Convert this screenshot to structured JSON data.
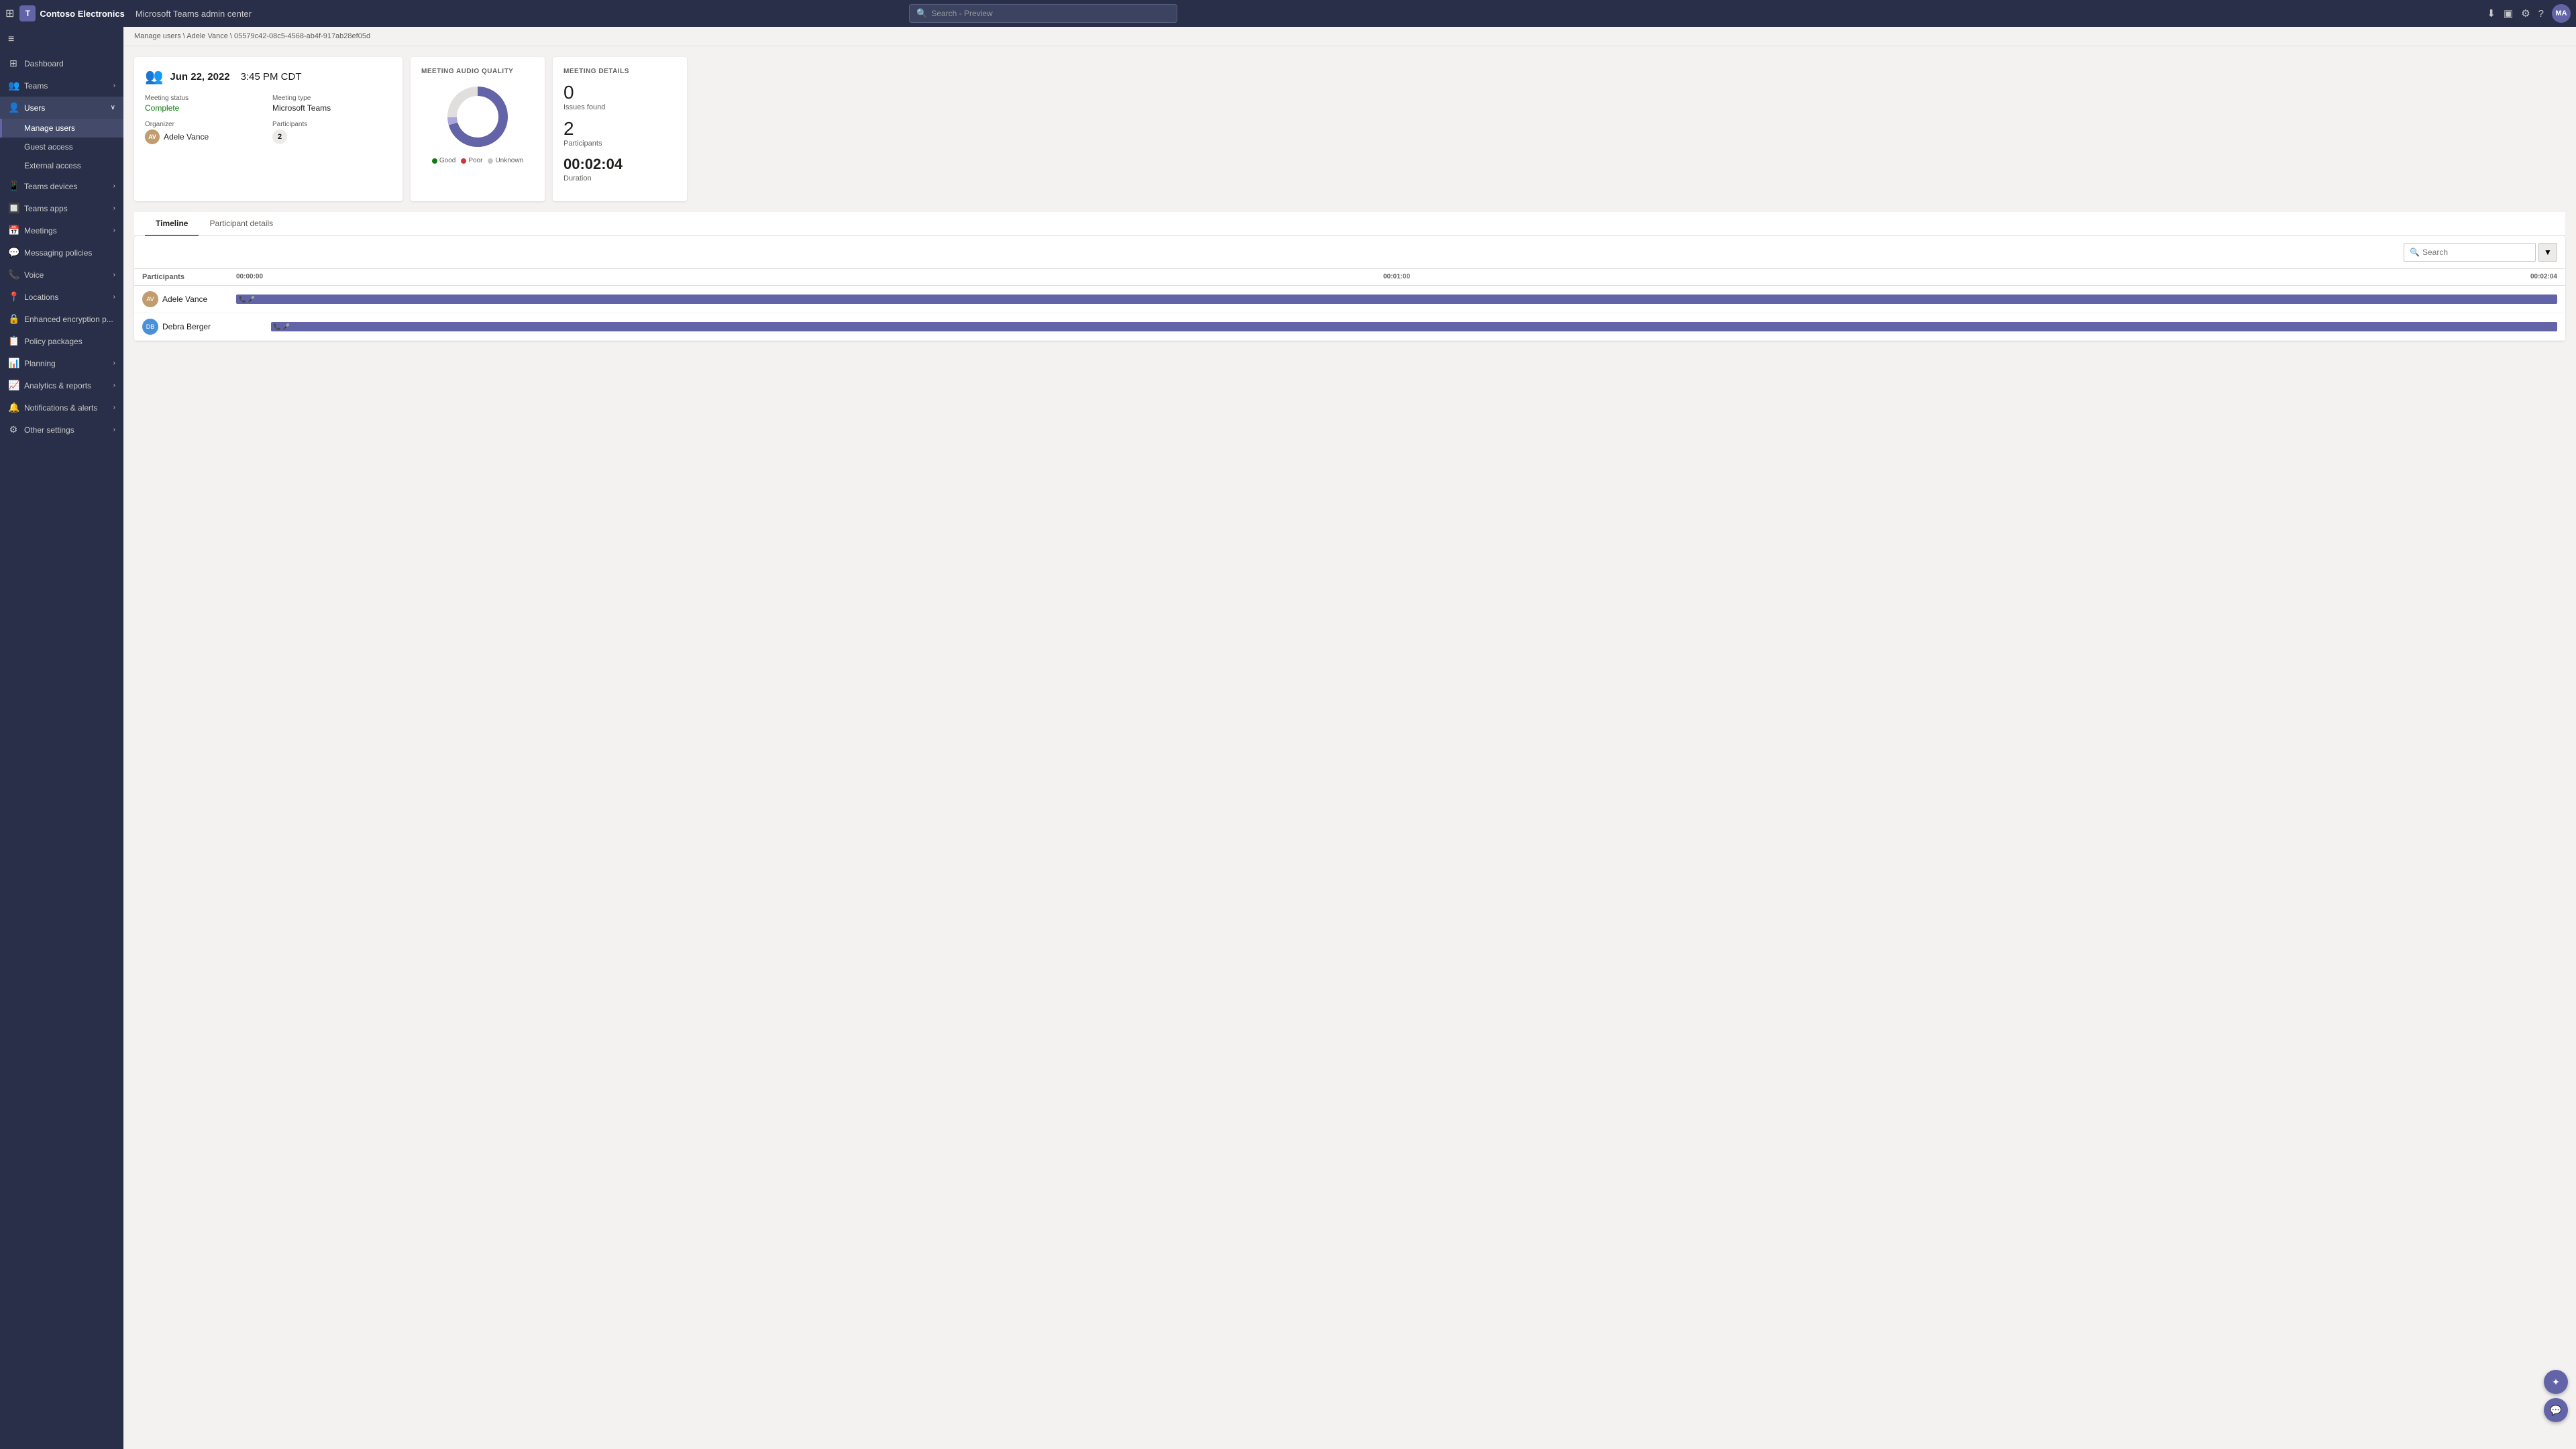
{
  "topbar": {
    "apps_icon": "⊞",
    "logo_text": "Contoso Electronics",
    "admin_center_title": "Microsoft Teams admin center",
    "search_placeholder": "Search - Preview",
    "avatar_initials": "MA"
  },
  "breadcrumb": {
    "path": "Manage users \\ Adele Vance \\ 05579c42-08c5-4568-ab4f-917ab28ef05d"
  },
  "sidebar": {
    "toggle_icon": "≡",
    "items": [
      {
        "id": "dashboard",
        "icon": "⊞",
        "label": "Dashboard",
        "expandable": false
      },
      {
        "id": "teams",
        "icon": "👥",
        "label": "Teams",
        "expandable": true
      },
      {
        "id": "users",
        "icon": "👤",
        "label": "Users",
        "expandable": true,
        "expanded": true
      },
      {
        "id": "teams-devices",
        "icon": "📱",
        "label": "Teams devices",
        "expandable": true
      },
      {
        "id": "teams-apps",
        "icon": "🔲",
        "label": "Teams apps",
        "expandable": true
      },
      {
        "id": "meetings",
        "icon": "📅",
        "label": "Meetings",
        "expandable": true
      },
      {
        "id": "messaging",
        "icon": "💬",
        "label": "Messaging policies",
        "expandable": false
      },
      {
        "id": "voice",
        "icon": "📞",
        "label": "Voice",
        "expandable": true
      },
      {
        "id": "locations",
        "icon": "📍",
        "label": "Locations",
        "expandable": true
      },
      {
        "id": "encryption",
        "icon": "🔒",
        "label": "Enhanced encryption p...",
        "expandable": false
      },
      {
        "id": "policy",
        "icon": "📋",
        "label": "Policy packages",
        "expandable": false
      },
      {
        "id": "planning",
        "icon": "📊",
        "label": "Planning",
        "expandable": true
      },
      {
        "id": "analytics",
        "icon": "📈",
        "label": "Analytics & reports",
        "expandable": true
      },
      {
        "id": "notifications",
        "icon": "🔔",
        "label": "Notifications & alerts",
        "expandable": true
      },
      {
        "id": "other",
        "icon": "⚙",
        "label": "Other settings",
        "expandable": true
      }
    ],
    "sub_items": [
      {
        "id": "manage-users",
        "label": "Manage users",
        "active": true
      },
      {
        "id": "guest-access",
        "label": "Guest access"
      },
      {
        "id": "external-access",
        "label": "External access"
      }
    ]
  },
  "meeting": {
    "icon": "👥",
    "date": "Jun 22, 2022",
    "time": "3:45 PM CDT",
    "status_label": "Meeting status",
    "status_value": "Complete",
    "type_label": "Meeting type",
    "type_value": "Microsoft Teams",
    "organizer_label": "Organizer",
    "organizer_name": "Adele Vance",
    "organizer_initials": "AV",
    "participants_label": "Participants",
    "participants_count": "2"
  },
  "audio_quality": {
    "title": "MEETING AUDIO QUALITY",
    "legend": [
      {
        "label": "Good",
        "color": "#107c10"
      },
      {
        "label": "Poor",
        "color": "#d13438"
      },
      {
        "label": "Unknown",
        "color": "#c8c6c4"
      }
    ],
    "donut": {
      "good_pct": 0,
      "poor_pct": 30,
      "unknown_pct": 70,
      "colors": [
        "#107c10",
        "#d13438",
        "#c8c6c4"
      ]
    }
  },
  "meeting_details": {
    "title": "MEETING DETAILS",
    "issues_value": "0",
    "issues_label": "Issues found",
    "participants_value": "2",
    "participants_label": "Participants",
    "duration_value": "00:02:04",
    "duration_label": "Duration"
  },
  "tabs": [
    {
      "id": "timeline",
      "label": "Timeline",
      "active": true
    },
    {
      "id": "participant-details",
      "label": "Participant details",
      "active": false
    }
  ],
  "timeline": {
    "search_placeholder": "Search",
    "columns": {
      "participants": "Participants",
      "time_start": "00:00:00",
      "time_mid": "00:01:00",
      "time_end": "00:02:04"
    },
    "rows": [
      {
        "name": "Adele Vance",
        "initials": "AV",
        "avatar_color": "#c19c6e",
        "bar_start_pct": 0,
        "bar_width_pct": 100
      },
      {
        "name": "Debra Berger",
        "initials": "DB",
        "avatar_color": "#4a90d9",
        "bar_start_pct": 1.5,
        "bar_width_pct": 98.5
      }
    ]
  },
  "floating": {
    "btn1_icon": "✦",
    "btn2_icon": "💬"
  }
}
